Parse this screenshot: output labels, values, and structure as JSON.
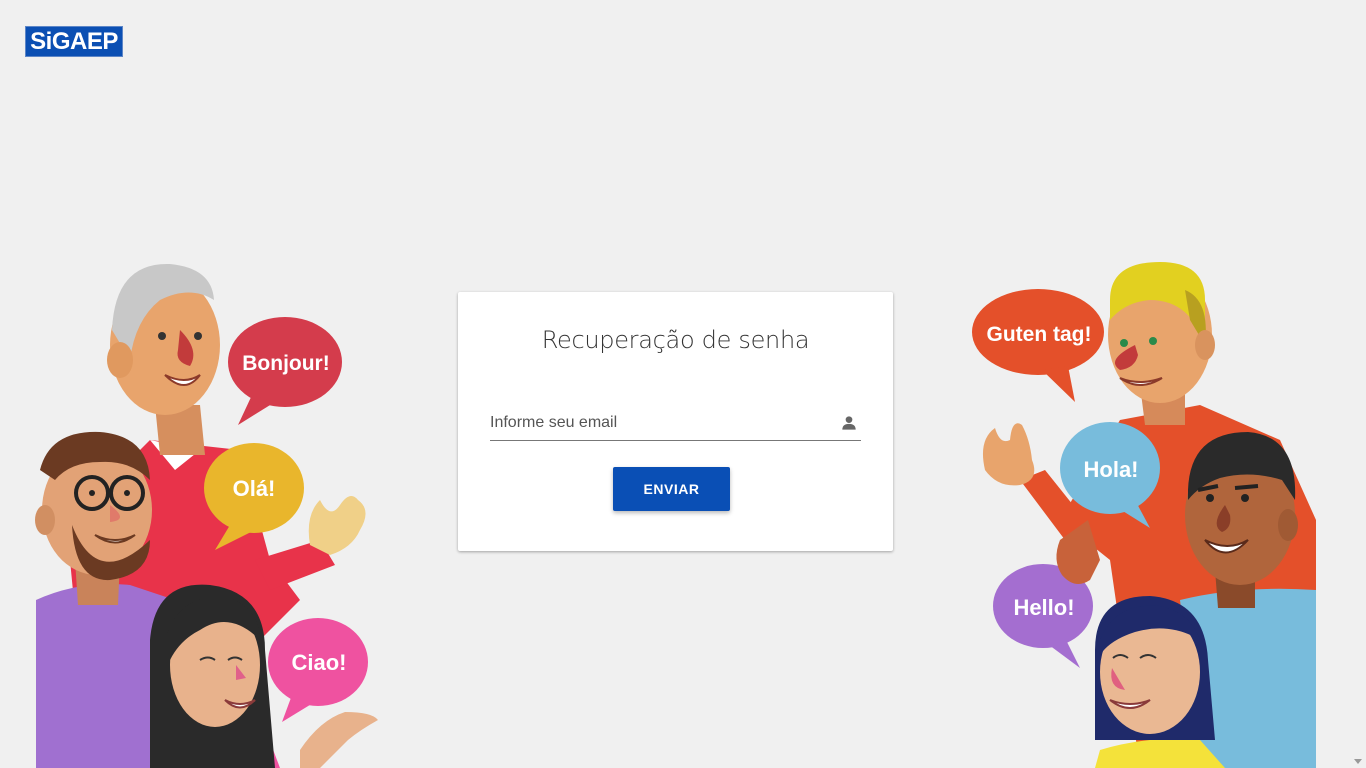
{
  "logo": {
    "text": "SiGAEP"
  },
  "card": {
    "title": "Recuperação de senha",
    "email_placeholder": "Informe seu email",
    "email_value": "",
    "submit_label": "ENVIAR"
  },
  "illustration": {
    "left_bubbles": [
      "Bonjour!",
      "Olá!",
      "Ciao!"
    ],
    "right_bubbles": [
      "Guten tag!",
      "Hola!",
      "Hello!"
    ]
  },
  "colors": {
    "background": "#f0f0f0",
    "brand_blue": "#0a4fb5",
    "bubble_red": "#d43c4c",
    "bubble_yellow": "#e9b62c",
    "bubble_pink": "#ef52a0",
    "bubble_orange": "#e4502a",
    "bubble_lightblue": "#78bcdc",
    "bubble_purple": "#a46ed0"
  }
}
